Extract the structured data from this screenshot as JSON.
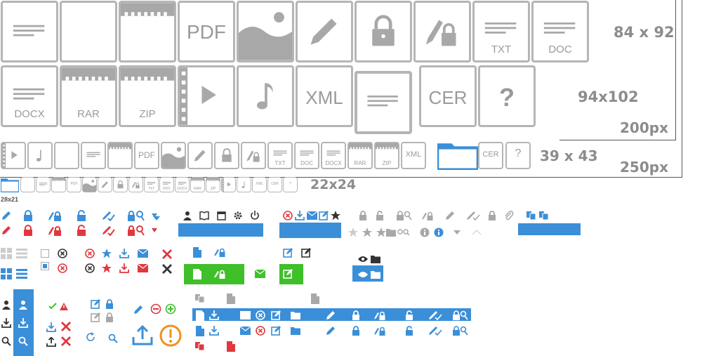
{
  "size_labels": {
    "large": "84 x 92",
    "medium": "94x102",
    "px200": "200px",
    "small": "39 x 43",
    "px250": "250px",
    "tiny": "22x24",
    "micro": "28x21"
  },
  "tile_labels": {
    "pdf": "PDF",
    "txt": "TXT",
    "doc": "DOC",
    "docx": "DOCX",
    "rar": "RAR",
    "zip": "ZIP",
    "xml": "XML",
    "cer": "CER",
    "unknown": "?"
  },
  "colors": {
    "tile_border": "#b5b5b5",
    "tile_glyph": "#a8a8a8",
    "accent_blue": "#3a8fd8",
    "success_green": "#3fbf2a",
    "danger_red": "#e0383e",
    "warning_orange": "#f0901e",
    "dark": "#333333"
  }
}
